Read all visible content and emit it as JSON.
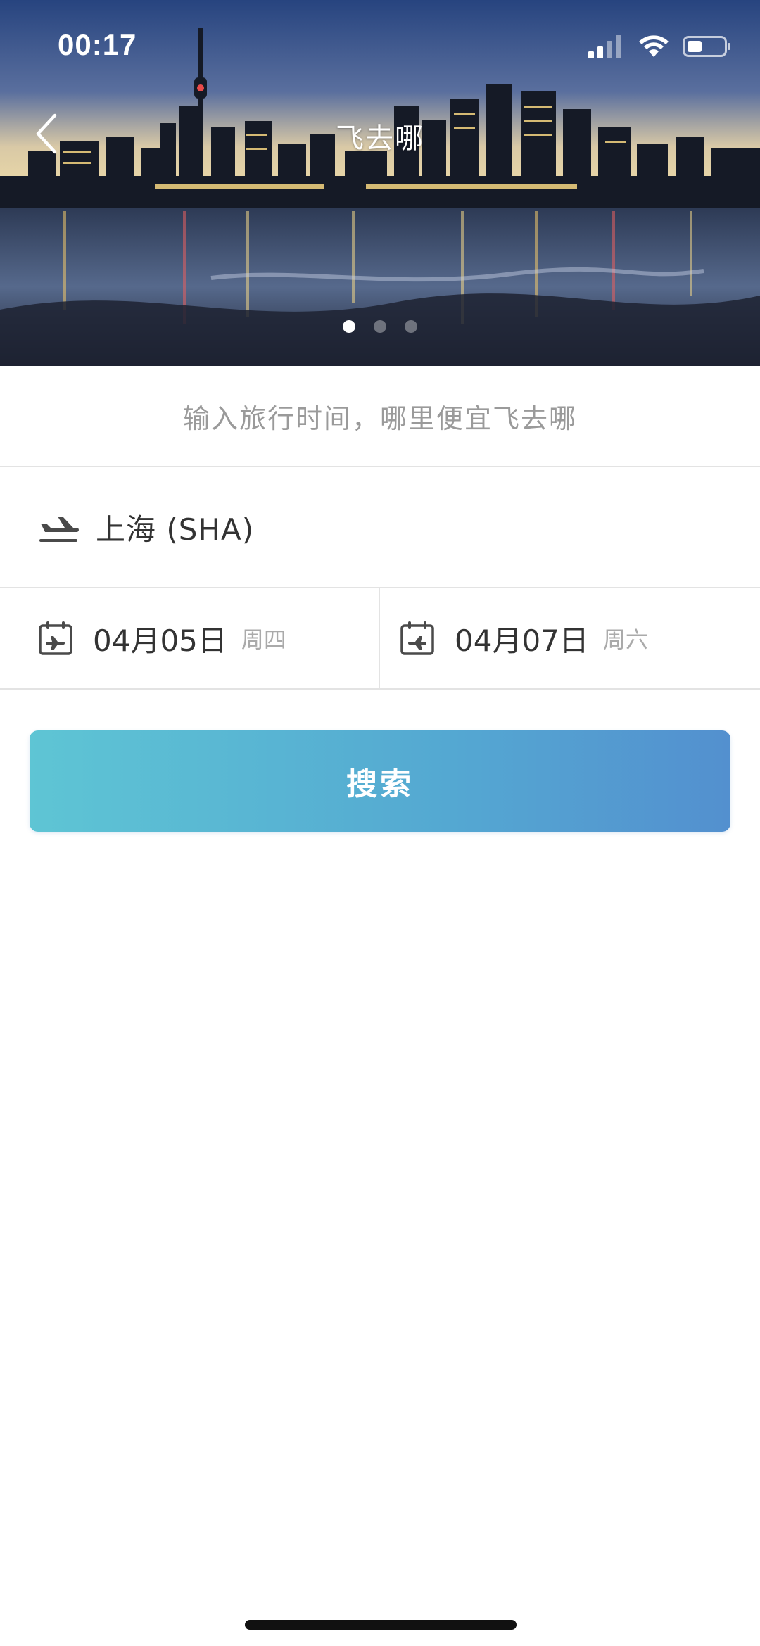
{
  "status_bar": {
    "time": "00:17"
  },
  "nav": {
    "title": "飞去哪"
  },
  "carousel": {
    "count": 3,
    "active_index": 0
  },
  "hint": {
    "text": "输入旅行时间，哪里便宜飞去哪"
  },
  "departure": {
    "city": "上海 (SHA)",
    "icon": "takeoff-icon"
  },
  "dates": {
    "depart": {
      "date": "04月05日",
      "weekday": "周四",
      "icon": "calendar-depart-icon"
    },
    "return": {
      "date": "04月07日",
      "weekday": "周六",
      "icon": "calendar-return-icon"
    }
  },
  "search": {
    "label": "搜索"
  },
  "colors": {
    "accent_start": "#5ec5d4",
    "accent_end": "#5390cf",
    "text_primary": "#333333",
    "text_secondary": "#9a9a9a"
  }
}
